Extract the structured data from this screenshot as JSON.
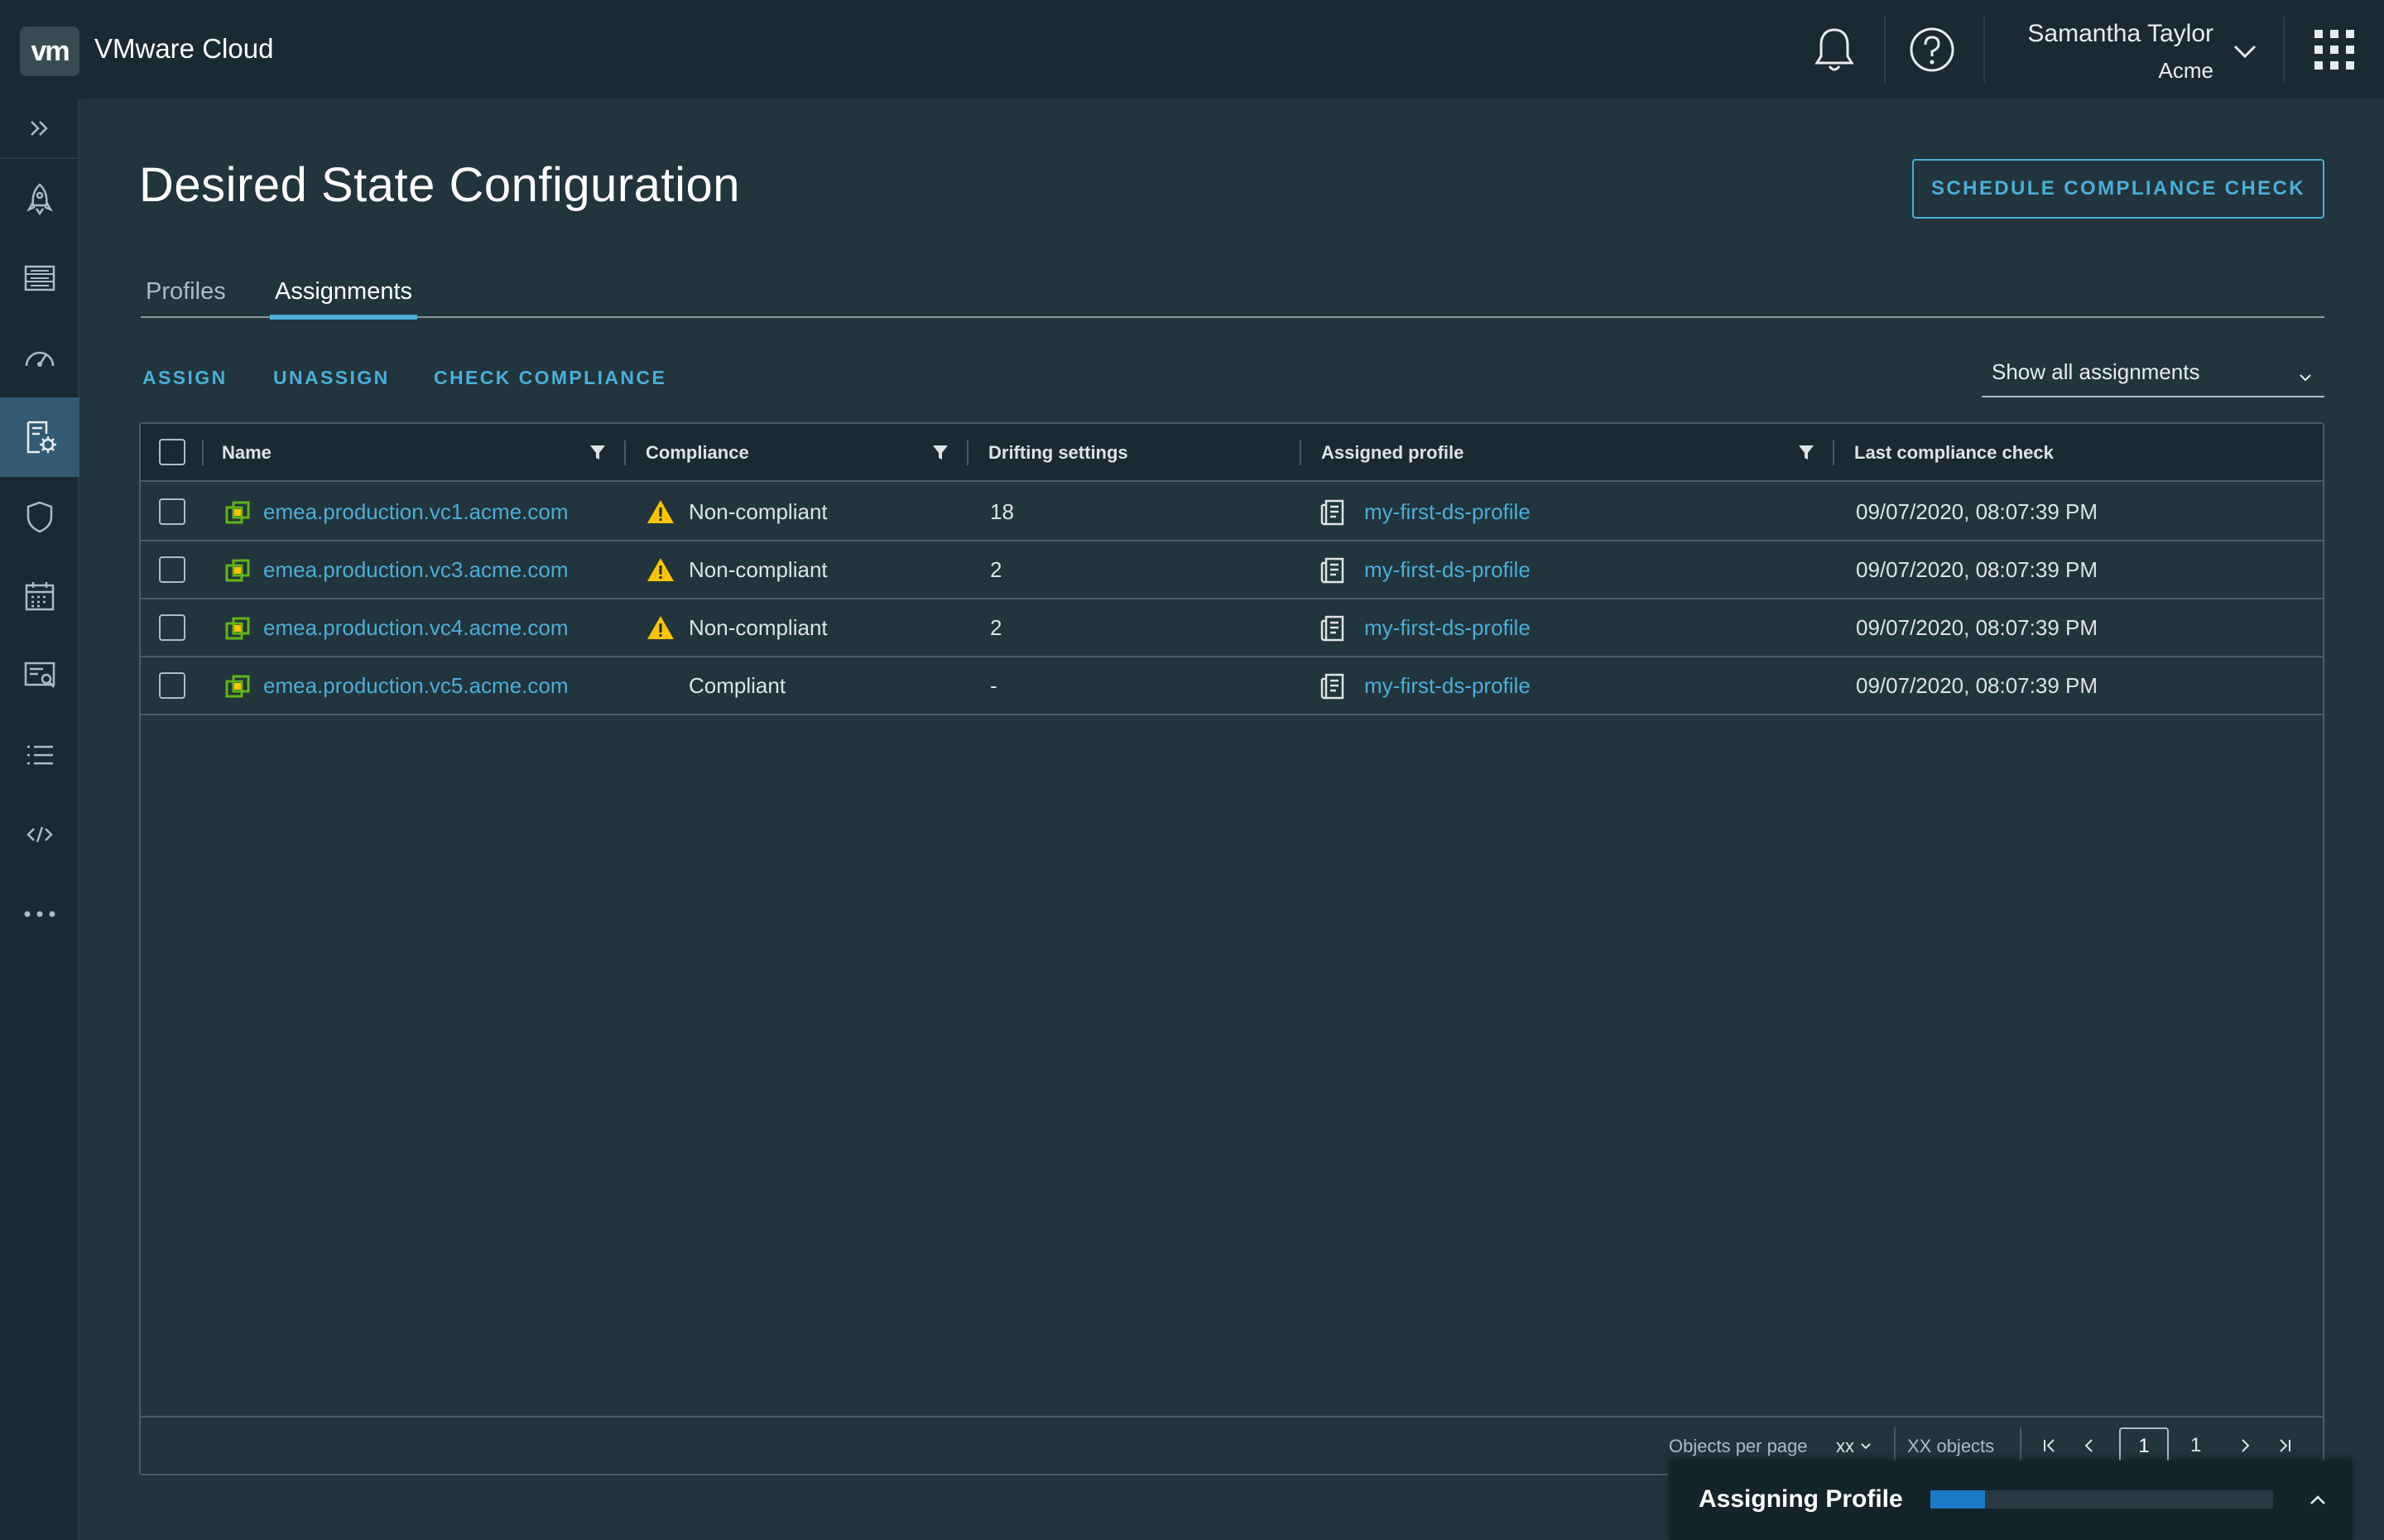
{
  "header": {
    "logo_text": "vm",
    "app_title": "VMware Cloud",
    "user_name": "Samantha Taylor",
    "user_org": "Acme",
    "icons": [
      "bell-icon",
      "help-icon",
      "chevron-down-icon",
      "app-grid-icon"
    ]
  },
  "nav": {
    "items": [
      "expand-icon",
      "rocket-icon",
      "inventory-icon",
      "dashboard-icon",
      "desired-state-icon",
      "shield-icon",
      "calendar-icon",
      "search-list-icon",
      "list-icon",
      "code-icon",
      "more-icon"
    ],
    "active": "desired-state-icon"
  },
  "page": {
    "title": "Desired State Configuration",
    "schedule_button": "SCHEDULE COMPLIANCE CHECK"
  },
  "tabs": [
    {
      "label": "Profiles",
      "active": false
    },
    {
      "label": "Assignments",
      "active": true
    }
  ],
  "actions": {
    "assign": "ASSIGN",
    "unassign": "UNASSIGN",
    "check_compliance": "CHECK COMPLIANCE",
    "filter_select": "Show all assignments"
  },
  "grid": {
    "columns": [
      "Name",
      "Compliance",
      "Drifting settings",
      "Assigned profile",
      "Last compliance check"
    ],
    "rows": [
      {
        "name": "emea.production.vc1.acme.com",
        "compliance": "Non-compliant",
        "warning": true,
        "drift": "18",
        "profile": "my-first-ds-profile",
        "last_check": "09/07/2020, 08:07:39 PM"
      },
      {
        "name": "emea.production.vc3.acme.com",
        "compliance": "Non-compliant",
        "warning": true,
        "drift": "2",
        "profile": "my-first-ds-profile",
        "last_check": "09/07/2020, 08:07:39 PM"
      },
      {
        "name": "emea.production.vc4.acme.com",
        "compliance": "Non-compliant",
        "warning": true,
        "drift": "2",
        "profile": "my-first-ds-profile",
        "last_check": "09/07/2020, 08:07:39 PM"
      },
      {
        "name": "emea.production.vc5.acme.com",
        "compliance": "Compliant",
        "warning": false,
        "drift": "-",
        "profile": "my-first-ds-profile",
        "last_check": "09/07/2020, 08:07:39 PM"
      }
    ],
    "footer": {
      "objects_per_page_label": "Objects per page",
      "objects_per_page_value": "xx",
      "objects_count": "XX objects",
      "current_page": "1",
      "total_pages": "1"
    }
  },
  "assign_popup": {
    "label": "Assigning Profile",
    "progress": 0.16
  },
  "colors": {
    "accent": "#49afd9",
    "warning": "#fac400",
    "vcenter_green": "#60b515",
    "progress": "#1a7ac6"
  }
}
